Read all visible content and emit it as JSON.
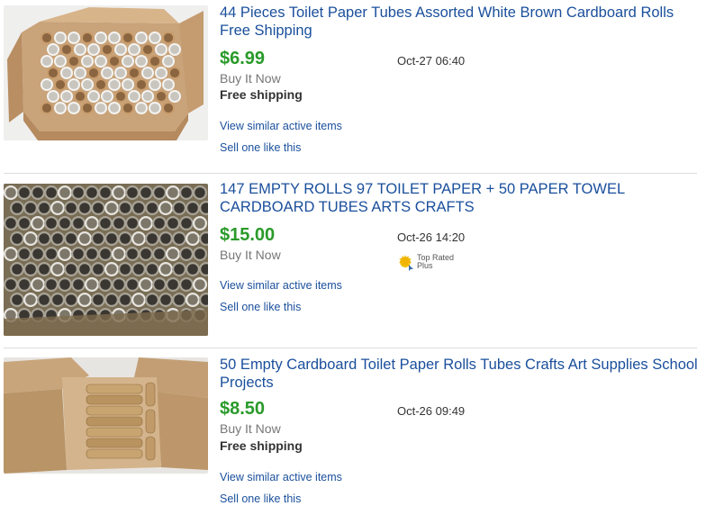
{
  "listings": [
    {
      "title": "44 Pieces Toilet Paper Tubes Assorted White Brown Cardboard Rolls Free Shipping",
      "price": "$6.99",
      "format": "Buy It Now",
      "shipping": "Free shipping",
      "time": "Oct-27 06:40",
      "view_similar": "View similar active items",
      "sell_one": "Sell one like this"
    },
    {
      "title": "147 EMPTY ROLLS 97 TOILET PAPER + 50 PAPER TOWEL CARDBOARD TUBES ARTS CRAFTS",
      "price": "$15.00",
      "format": "Buy It Now",
      "time": "Oct-26 14:20",
      "badge": "Top Rated Plus",
      "view_similar": "View similar active items",
      "sell_one": "Sell one like this"
    },
    {
      "title": "50 Empty Cardboard Toilet Paper Rolls Tubes Crafts Art Supplies School Projects",
      "price": "$8.50",
      "format": "Buy It Now",
      "shipping": "Free shipping",
      "time": "Oct-26 09:49",
      "view_similar": "View similar active items",
      "sell_one": "Sell one like this"
    }
  ],
  "colors": {
    "title_link": "#1a4f9c",
    "price": "#2a9a2a",
    "muted": "#767676",
    "divider": "#dddddd"
  },
  "icons": {
    "top_rated": "top-rated-plus-icon"
  }
}
